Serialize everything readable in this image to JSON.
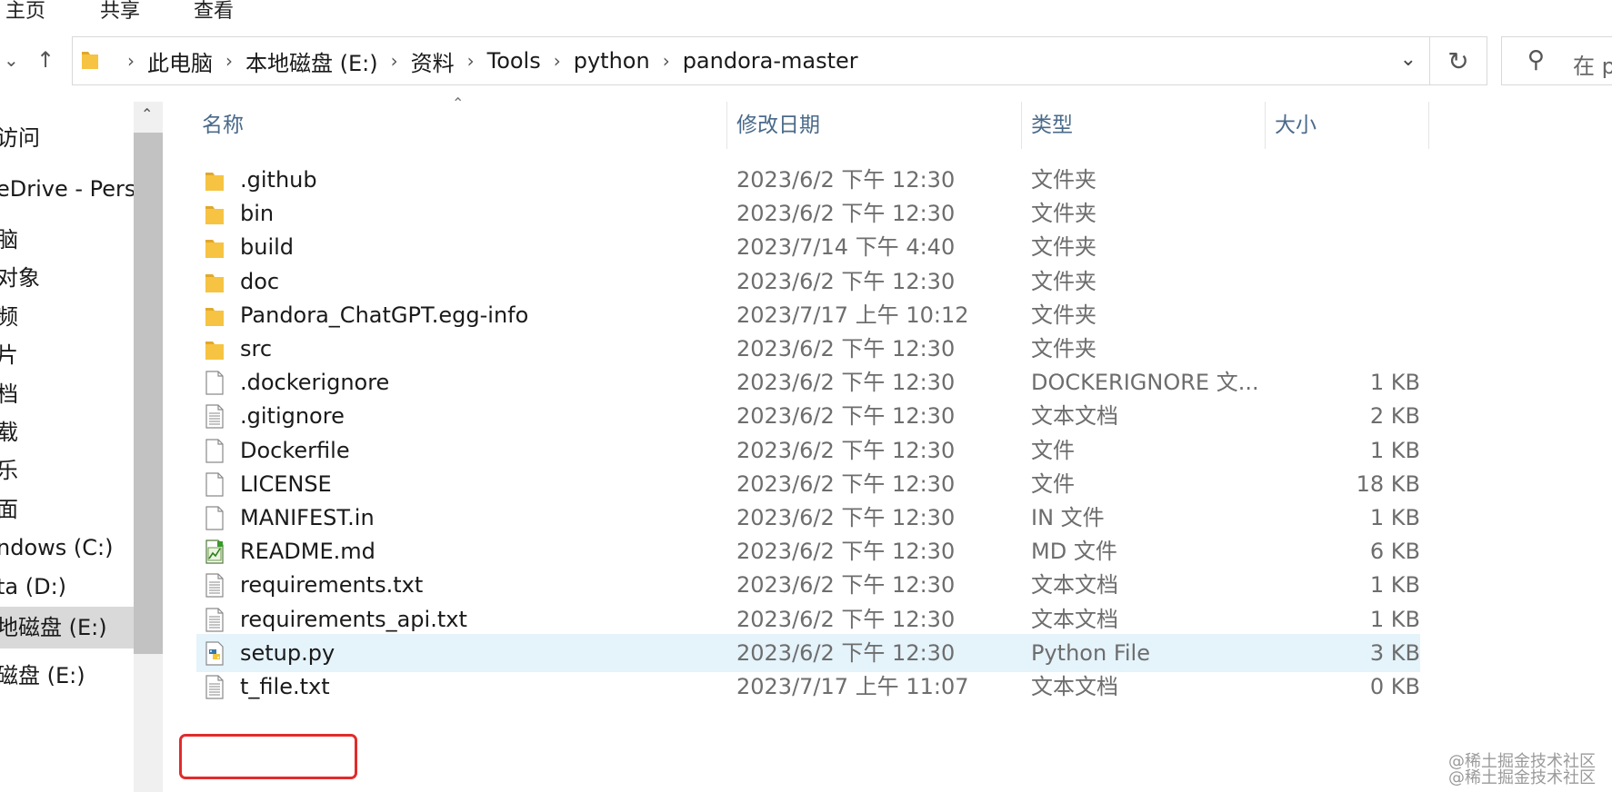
{
  "ribbon": {
    "tabs": [
      "主页",
      "共享",
      "查看"
    ]
  },
  "address": {
    "crumbs": [
      "此电脑",
      "本地磁盘 (E:)",
      "资料",
      "Tools",
      "python",
      "pandora-master"
    ],
    "search_placeholder": "在 p"
  },
  "nav": {
    "items": [
      {
        "label": "访问",
        "selected": false
      },
      {
        "label": "eDrive - Persc",
        "selected": false
      },
      {
        "label": "脑",
        "selected": false
      },
      {
        "label": "对象",
        "selected": false
      },
      {
        "label": "频",
        "selected": false
      },
      {
        "label": "片",
        "selected": false
      },
      {
        "label": "档",
        "selected": false
      },
      {
        "label": "载",
        "selected": false
      },
      {
        "label": "乐",
        "selected": false
      },
      {
        "label": "面",
        "selected": false
      },
      {
        "label": "ndows (C:)",
        "selected": false
      },
      {
        "label": "ta (D:)",
        "selected": false
      },
      {
        "label": "地磁盘 (E:)",
        "selected": true
      },
      {
        "label": "磁盘 (E:)",
        "selected": false
      }
    ]
  },
  "columns": {
    "name": "名称",
    "date": "修改日期",
    "type": "类型",
    "size": "大小"
  },
  "files": [
    {
      "name": ".github",
      "date": "2023/6/2 下午 12:30",
      "type": "文件夹",
      "size": "",
      "icon": "folder-icon",
      "selected": false
    },
    {
      "name": "bin",
      "date": "2023/6/2 下午 12:30",
      "type": "文件夹",
      "size": "",
      "icon": "folder-icon",
      "selected": false
    },
    {
      "name": "build",
      "date": "2023/7/14 下午 4:40",
      "type": "文件夹",
      "size": "",
      "icon": "folder-icon",
      "selected": false
    },
    {
      "name": "doc",
      "date": "2023/6/2 下午 12:30",
      "type": "文件夹",
      "size": "",
      "icon": "folder-icon",
      "selected": false
    },
    {
      "name": "Pandora_ChatGPT.egg-info",
      "date": "2023/7/17 上午 10:12",
      "type": "文件夹",
      "size": "",
      "icon": "folder-icon",
      "selected": false
    },
    {
      "name": "src",
      "date": "2023/6/2 下午 12:30",
      "type": "文件夹",
      "size": "",
      "icon": "folder-icon",
      "selected": false
    },
    {
      "name": ".dockerignore",
      "date": "2023/6/2 下午 12:30",
      "type": "DOCKERIGNORE 文...",
      "size": "1 KB",
      "icon": "blank-file-icon",
      "selected": false
    },
    {
      "name": ".gitignore",
      "date": "2023/6/2 下午 12:30",
      "type": "文本文档",
      "size": "2 KB",
      "icon": "text-file-icon",
      "selected": false
    },
    {
      "name": "Dockerfile",
      "date": "2023/6/2 下午 12:30",
      "type": "文件",
      "size": "1 KB",
      "icon": "blank-file-icon",
      "selected": false
    },
    {
      "name": "LICENSE",
      "date": "2023/6/2 下午 12:30",
      "type": "文件",
      "size": "18 KB",
      "icon": "blank-file-icon",
      "selected": false
    },
    {
      "name": "MANIFEST.in",
      "date": "2023/6/2 下午 12:30",
      "type": "IN 文件",
      "size": "1 KB",
      "icon": "blank-file-icon",
      "selected": false
    },
    {
      "name": "README.md",
      "date": "2023/6/2 下午 12:30",
      "type": "MD 文件",
      "size": "6 KB",
      "icon": "markdown-file-icon",
      "selected": false
    },
    {
      "name": "requirements.txt",
      "date": "2023/6/2 下午 12:30",
      "type": "文本文档",
      "size": "1 KB",
      "icon": "text-file-icon",
      "selected": false
    },
    {
      "name": "requirements_api.txt",
      "date": "2023/6/2 下午 12:30",
      "type": "文本文档",
      "size": "1 KB",
      "icon": "text-file-icon",
      "selected": false
    },
    {
      "name": "setup.py",
      "date": "2023/6/2 下午 12:30",
      "type": "Python File",
      "size": "3 KB",
      "icon": "python-file-icon",
      "selected": true
    },
    {
      "name": "t_file.txt",
      "date": "2023/7/17 上午 11:07",
      "type": "文本文档",
      "size": "0 KB",
      "icon": "text-file-icon",
      "selected": false
    }
  ],
  "watermark": [
    "@稀土掘金技术社区",
    "@稀土掘金技术社区"
  ],
  "colors": {
    "folder": "#f6c343",
    "selection": "#e5f3fb",
    "highlight": "#e22b2b",
    "header_text": "#4a6a8a"
  }
}
